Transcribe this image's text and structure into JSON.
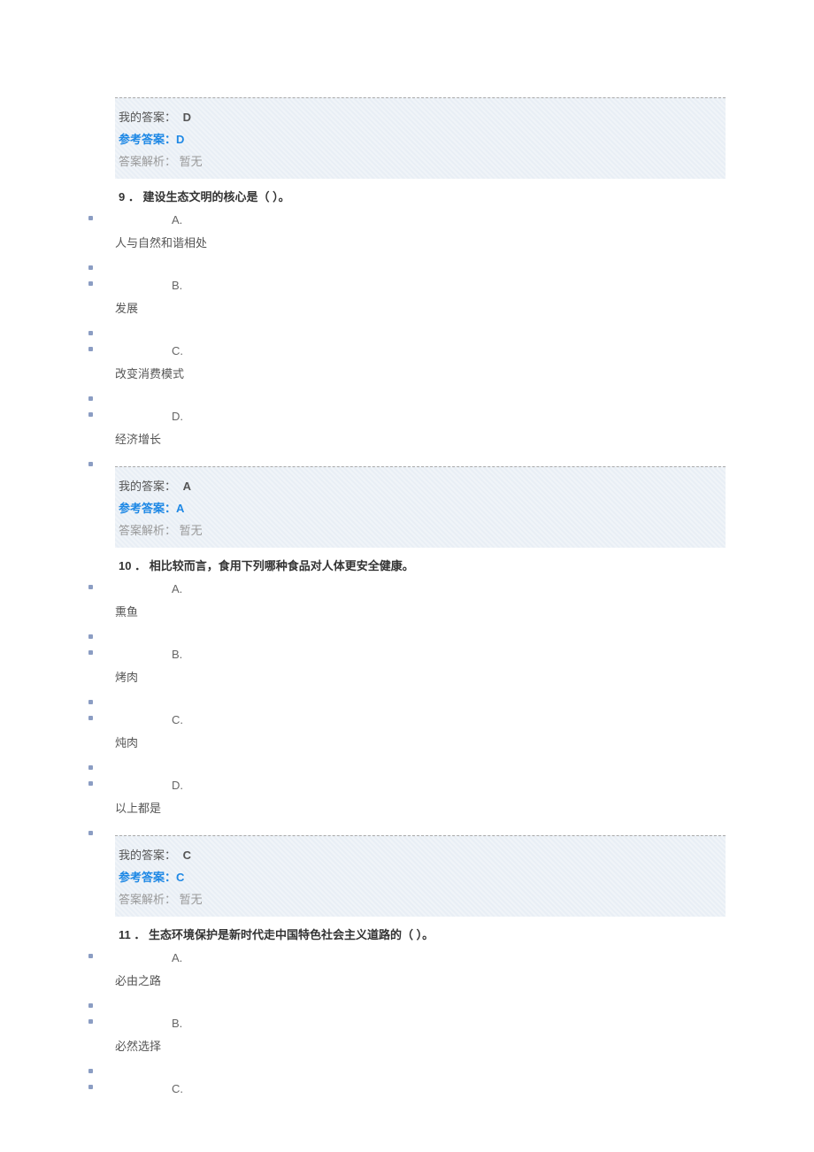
{
  "labels": {
    "myAnswer": "我的答案：",
    "refAnswer": "参考答案：",
    "analysisLabel": "答案解析：",
    "analysisValue": "暂无"
  },
  "block1": {
    "myAnswer": "D",
    "refAnswer": "D"
  },
  "q9": {
    "num": "9",
    "text": "建设生态文明的核心是（ ）。",
    "options": {
      "A": {
        "letter": "A.",
        "text": "人与自然和谐相处"
      },
      "B": {
        "letter": "B.",
        "text": "发展"
      },
      "C": {
        "letter": "C.",
        "text": "改变消费模式"
      },
      "D": {
        "letter": "D.",
        "text": "经济增长"
      }
    },
    "myAnswer": "A",
    "refAnswer": "A"
  },
  "q10": {
    "num": "10",
    "text": "相比较而言，食用下列哪种食品对人体更安全健康。",
    "options": {
      "A": {
        "letter": "A.",
        "text": "熏鱼"
      },
      "B": {
        "letter": "B.",
        "text": "烤肉"
      },
      "C": {
        "letter": "C.",
        "text": "炖肉"
      },
      "D": {
        "letter": "D.",
        "text": "以上都是"
      }
    },
    "myAnswer": "C",
    "refAnswer": "C"
  },
  "q11": {
    "num": "11",
    "text": "生态环境保护是新时代走中国特色社会主义道路的（ ）。",
    "options": {
      "A": {
        "letter": "A.",
        "text": "必由之路"
      },
      "B": {
        "letter": "B.",
        "text": "必然选择"
      },
      "C": {
        "letter": "C.",
        "text": ""
      }
    }
  }
}
